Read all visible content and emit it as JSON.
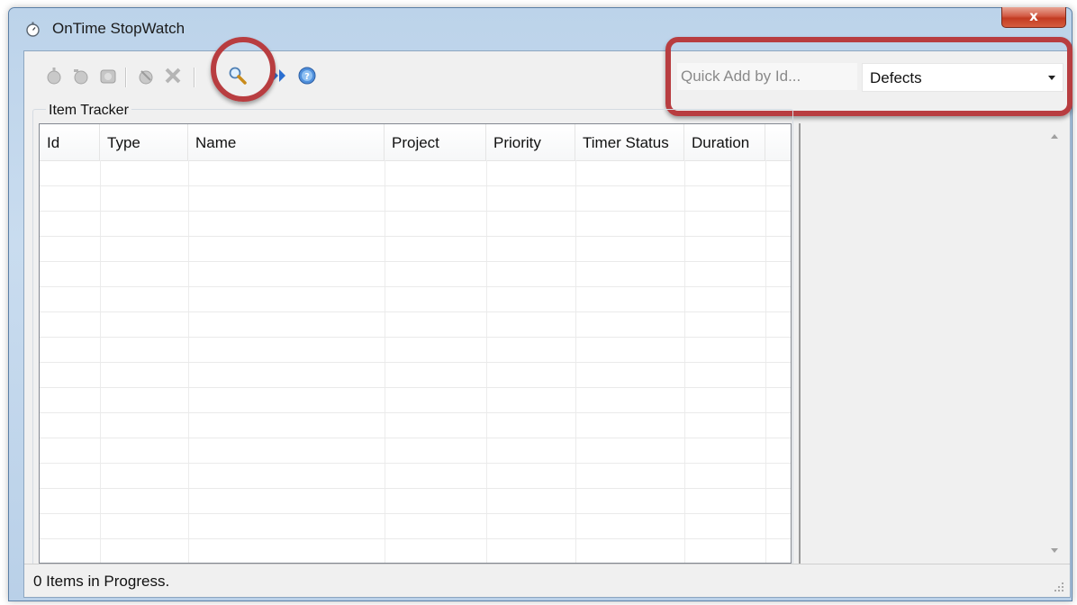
{
  "window": {
    "title": "OnTime StopWatch",
    "close_label": "x"
  },
  "toolbar": {
    "buttons": [
      {
        "icon": "add-item-icon",
        "enabled": false
      },
      {
        "icon": "add-item-alt-icon",
        "enabled": false
      },
      {
        "icon": "add-batch-icon",
        "enabled": false
      },
      {
        "icon": "edit-item-icon",
        "enabled": false
      },
      {
        "icon": "remove-item-icon",
        "enabled": false
      },
      {
        "icon": "search-icon",
        "enabled": true
      },
      {
        "icon": "fast-forward-icon",
        "enabled": true
      },
      {
        "icon": "help-icon",
        "enabled": true
      }
    ],
    "quick_add_placeholder": "Quick Add by Id...",
    "item_type_selected": "Defects"
  },
  "item_tracker": {
    "label": "Item Tracker",
    "columns": [
      "Id",
      "Type",
      "Name",
      "Project",
      "Priority",
      "Timer Status",
      "Duration"
    ],
    "rows": []
  },
  "status": {
    "text": "0 Items in Progress."
  },
  "colors": {
    "highlight": "#b83d40",
    "title_gradient_top": "#bcd3ea",
    "client_bg": "#f0f0f0"
  }
}
